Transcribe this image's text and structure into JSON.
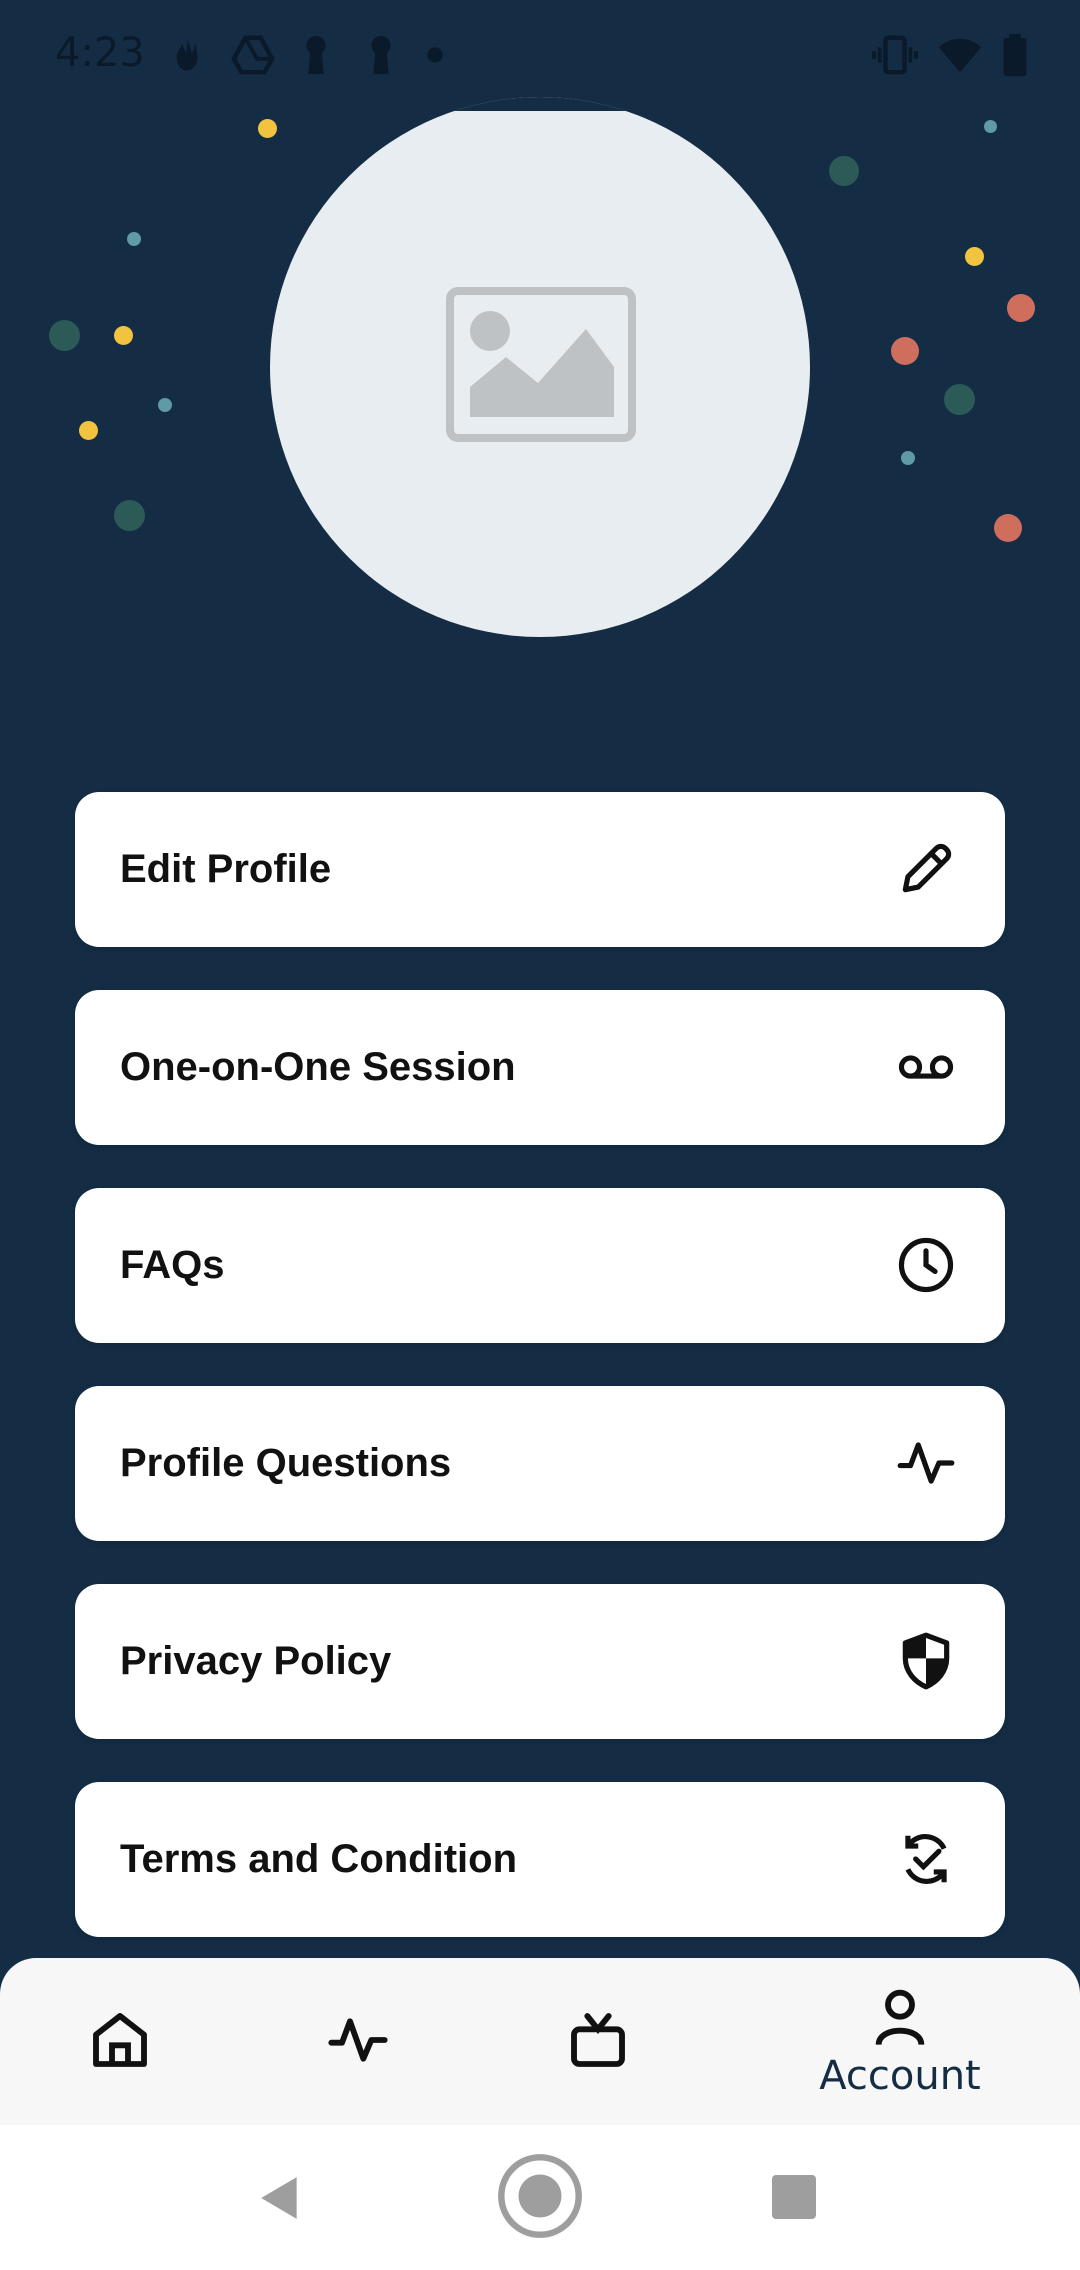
{
  "status_bar": {
    "time": "4:23",
    "icons_left": [
      "hand-icon",
      "drive-icon",
      "keyhole-icon",
      "keyhole-icon",
      "dot-icon"
    ],
    "icons_right": [
      "vibrate-icon",
      "wifi-icon",
      "battery-icon"
    ]
  },
  "profile": {
    "avatar_icon": "image-placeholder-icon"
  },
  "menu": {
    "items": [
      {
        "label": "Edit Profile",
        "icon": "pencil-icon"
      },
      {
        "label": "One-on-One Session",
        "icon": "voicemail-icon"
      },
      {
        "label": "FAQs",
        "icon": "clock-icon"
      },
      {
        "label": "Profile Questions",
        "icon": "activity-icon"
      },
      {
        "label": "Privacy Policy",
        "icon": "shield-icon"
      },
      {
        "label": "Terms and Condition",
        "icon": "refresh-check-icon"
      }
    ]
  },
  "bottom_nav": {
    "items": [
      {
        "icon": "home-icon",
        "label": ""
      },
      {
        "icon": "activity-icon",
        "label": ""
      },
      {
        "icon": "tv-icon",
        "label": ""
      },
      {
        "icon": "account-icon",
        "label": "Account",
        "active": true
      }
    ]
  },
  "system_nav": {
    "buttons": [
      "back-icon",
      "home-circle-icon",
      "recents-icon"
    ]
  },
  "colors": {
    "background": "#142d45",
    "card": "#ffffff",
    "avatar_bg": "#e7edf1",
    "dot_yellow": "#f2c33f",
    "dot_green": "#2b5a57",
    "dot_coral": "#d06e5e",
    "dot_teal": "#5f9aa6"
  }
}
